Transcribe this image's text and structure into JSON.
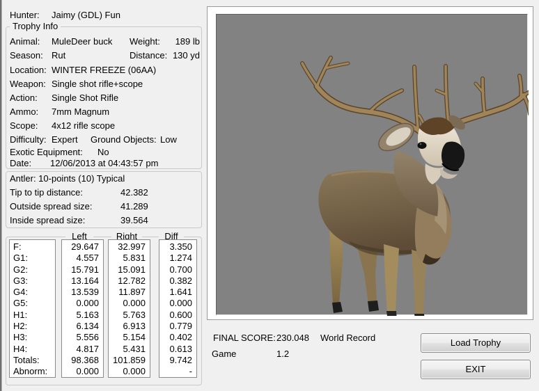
{
  "window": {
    "bg": "#f0f0f0",
    "viewport_bg": "#828282"
  },
  "hunter": {
    "label": "Hunter:",
    "value": "Jaimy (GDL) Fun"
  },
  "trophy": {
    "legend": "Trophy Info",
    "animal": {
      "label": "Animal:",
      "value": "MuleDeer buck"
    },
    "weight": {
      "label": "Weight:",
      "value": "189 lb"
    },
    "season": {
      "label": "Season:",
      "value": "Rut"
    },
    "distance": {
      "label": "Distance:",
      "value": "130 yd"
    },
    "location": {
      "label": "Location:",
      "value": "WINTER FREEZE (06AA)"
    },
    "weapon": {
      "label": "Weapon:",
      "value": "Single shot rifle+scope"
    },
    "action": {
      "label": "Action:",
      "value": "Single Shot Rifle"
    },
    "ammo": {
      "label": "Ammo:",
      "value": "7mm Magnum"
    },
    "scope": {
      "label": "Scope:",
      "value": "4x12 rifle scope"
    },
    "difficulty": {
      "label": "Difficulty:",
      "value": "Expert"
    },
    "ground_objects": {
      "label": "Ground Objects:",
      "value": "Low"
    },
    "exotic": {
      "label": "Exotic Equipment:",
      "value": "No"
    },
    "date": {
      "label": "Date:",
      "value": "12/06/2013 at 04:43:57 pm"
    }
  },
  "antler": {
    "summary": "Antler: 10-points (10) Typical",
    "tip_to_tip": {
      "label": "Tip to tip distance:",
      "value": "42.382"
    },
    "outside_spread": {
      "label": "Outside spread size:",
      "value": "41.289"
    },
    "inside_spread": {
      "label": "Inside spread size:",
      "value": "39.564"
    }
  },
  "score_table": {
    "col_headers": {
      "left": "Left",
      "right": "Right",
      "diff": "Diff"
    },
    "rows": [
      {
        "label": "F:",
        "left": "29.647",
        "right": "32.997",
        "diff": "3.350"
      },
      {
        "label": "G1:",
        "left": "4.557",
        "right": "5.831",
        "diff": "1.274"
      },
      {
        "label": "G2:",
        "left": "15.791",
        "right": "15.091",
        "diff": "0.700"
      },
      {
        "label": "G3:",
        "left": "13.164",
        "right": "12.782",
        "diff": "0.382"
      },
      {
        "label": "G4:",
        "left": "13.539",
        "right": "11.897",
        "diff": "1.641"
      },
      {
        "label": "G5:",
        "left": "0.000",
        "right": "0.000",
        "diff": "0.000"
      },
      {
        "label": "H1:",
        "left": "5.163",
        "right": "5.763",
        "diff": "0.600"
      },
      {
        "label": "H2:",
        "left": "6.134",
        "right": "6.913",
        "diff": "0.779"
      },
      {
        "label": "H3:",
        "left": "5.556",
        "right": "5.154",
        "diff": "0.402"
      },
      {
        "label": "H4:",
        "left": "4.817",
        "right": "5.431",
        "diff": "0.613"
      },
      {
        "label": "Totals:",
        "left": "98.368",
        "right": "101.859",
        "diff": "9.742"
      },
      {
        "label": "Abnorm:",
        "left": "0.000",
        "right": "0.000",
        "diff": "-"
      }
    ]
  },
  "summary": {
    "final_score_label": "FINAL SCORE:",
    "final_score": "230.048",
    "record": "World Record",
    "game_label": "Game",
    "game_value": "1.2"
  },
  "buttons": {
    "load_trophy": "Load Trophy",
    "exit": "EXIT"
  },
  "viewport": {
    "subject": "MuleDeer buck 3D trophy render"
  }
}
